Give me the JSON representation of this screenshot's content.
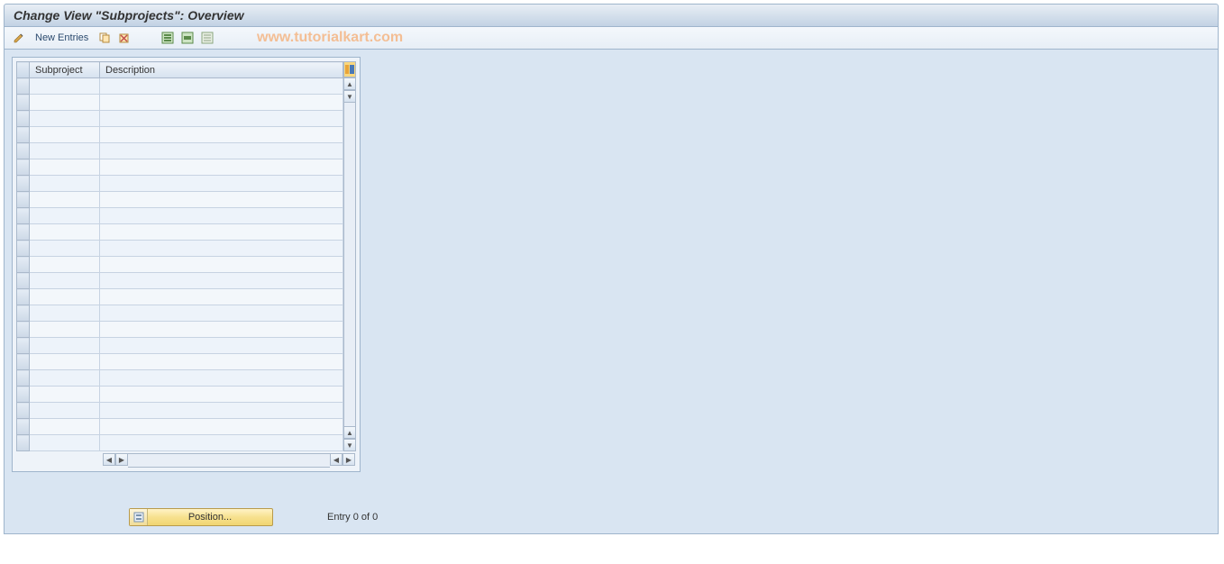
{
  "titlebar": {
    "title": "Change View \"Subprojects\": Overview"
  },
  "toolbar": {
    "new_entries_label": "New Entries",
    "icons": {
      "pencil": "edit-icon",
      "copy": "copy-icon",
      "delete": "delete-icon",
      "select_all": "select-all-icon",
      "select_block": "select-block-icon",
      "deselect_all": "deselect-all-icon"
    }
  },
  "watermark": "www.tutorialkart.com",
  "table": {
    "columns": {
      "subproject": "Subproject",
      "description": "Description"
    },
    "row_count": 23,
    "rows": []
  },
  "footer": {
    "position_label": "Position...",
    "entry_status": "Entry 0 of 0"
  }
}
